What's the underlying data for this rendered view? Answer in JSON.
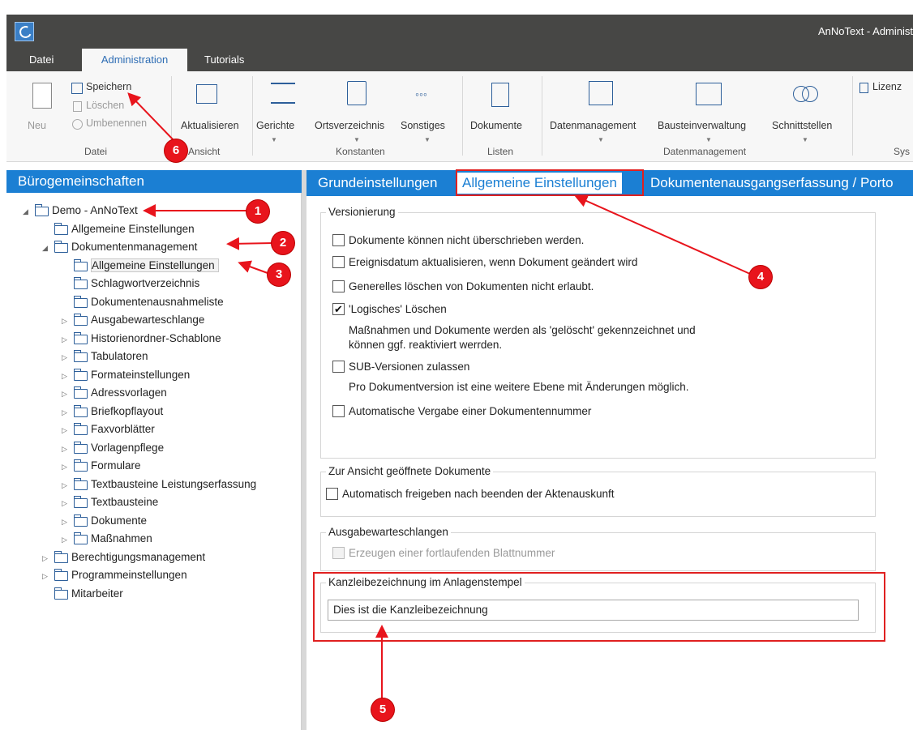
{
  "window": {
    "title": "AnNoText - Administ"
  },
  "tabs": [
    "Datei",
    "Administration",
    "Tutorials"
  ],
  "ribbon": {
    "datei": {
      "new": "Neu",
      "save": "Speichern",
      "delete": "Löschen",
      "rename": "Umbenennen",
      "group": "Datei"
    },
    "ansicht": {
      "refresh": "Aktualisieren",
      "group": "Ansicht"
    },
    "konstanten": {
      "courts": "Gerichte",
      "places": "Ortsverzeichnis",
      "misc": "Sonstiges",
      "group": "Konstanten"
    },
    "listen": {
      "docs": "Dokumente",
      "group": "Listen"
    },
    "datenmanagement": {
      "data": "Datenmanagement",
      "blocks": "Bausteinverwaltung",
      "interfaces": "Schnittstellen",
      "group": "Datenmanagement"
    },
    "sys": {
      "license": "Lizenz",
      "group": "Sys"
    }
  },
  "left_pane": {
    "title": "Bürogemeinschaften",
    "tree": [
      {
        "label": "Demo - AnNoText"
      },
      {
        "label": "Allgemeine Einstellungen"
      },
      {
        "label": "Dokumentenmanagement"
      },
      {
        "label": "Allgemeine Einstellungen"
      },
      {
        "label": "Schlagwortverzeichnis"
      },
      {
        "label": "Dokumentenausnahmeliste"
      },
      {
        "label": "Ausgabewarteschlange"
      },
      {
        "label": "Historienordner-Schablone"
      },
      {
        "label": "Tabulatoren"
      },
      {
        "label": "Formateinstellungen"
      },
      {
        "label": "Adressvorlagen"
      },
      {
        "label": "Briefkopflayout"
      },
      {
        "label": "Faxvorblätter"
      },
      {
        "label": "Vorlagenpflege"
      },
      {
        "label": "Formulare"
      },
      {
        "label": "Textbausteine Leistungserfassung"
      },
      {
        "label": "Textbausteine"
      },
      {
        "label": "Dokumente"
      },
      {
        "label": "Maßnahmen"
      },
      {
        "label": "Berechtigungsmanagement"
      },
      {
        "label": "Programmeinstellungen"
      },
      {
        "label": "Mitarbeiter"
      }
    ]
  },
  "content_tabs": [
    "Grundeinstellungen",
    "Allgemeine Einstellungen",
    "Dokumentenausgangserfassung / Porto"
  ],
  "versionierung": {
    "title": "Versionierung",
    "options": [
      {
        "label": "Dokumente können nicht überschrieben werden.",
        "checked": false
      },
      {
        "label": "Ereignisdatum aktualisieren, wenn Dokument geändert wird",
        "checked": false
      },
      {
        "label": "Generelles löschen von Dokumenten nicht erlaubt.",
        "checked": false
      },
      {
        "label": "'Logisches' Löschen",
        "checked": true
      },
      {
        "label": "SUB-Versionen zulassen",
        "checked": false
      },
      {
        "label": "Automatische Vergabe einer Dokumentennummer",
        "checked": false
      }
    ],
    "logisch_desc_1": "Maßnahmen und Dokumente werden als 'gelöscht' gekennzeichnet und",
    "logisch_desc_2": "können ggf. reaktiviert werrden.",
    "sub_desc": "Pro Dokumentversion ist eine weitere Ebene mit Änderungen möglich."
  },
  "ansicht_group": {
    "title": "Zur Ansicht geöffnete Dokumente",
    "option": "Automatisch freigeben nach beenden der Aktenauskunft"
  },
  "ausgabe_group": {
    "title": "Ausgabewarteschlangen",
    "option": "Erzeugen einer fortlaufenden Blattnummer"
  },
  "kanzlei_group": {
    "title": "Kanzleibezeichnung im Anlagenstempel",
    "value": "Dies ist die Kanzleibezeichnung"
  },
  "annotations": [
    "1",
    "2",
    "3",
    "4",
    "5",
    "6"
  ],
  "colors": {
    "accent": "#1b7fd3",
    "annotation": "#e8141c",
    "titlebar": "#474745"
  }
}
